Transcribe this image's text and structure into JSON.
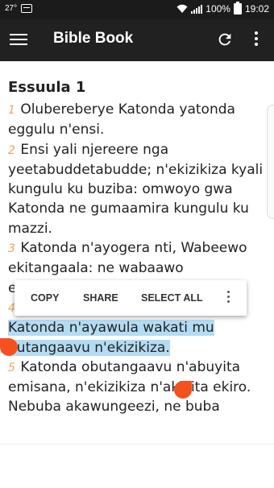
{
  "status_bar": {
    "left_text": "27°",
    "battery": "100%",
    "time": "19:02"
  },
  "app_bar": {
    "title": "Bible Book",
    "icons": [
      "menu-icon",
      "refresh-icon",
      "more-vert-icon"
    ]
  },
  "chapter": {
    "title": "Essuula 1",
    "verses": [
      {
        "num": "1",
        "text": "Olubereberye Katonda yatonda eggulu n'ensi."
      },
      {
        "num": "2",
        "text": "Ensi yali njereere nga yeetabuddetabudde; n'ekizikiza kyali kungulu ku buziba: omwoyo gwa Katonda ne gumaamira kungulu ku mazzi."
      },
      {
        "num": "3",
        "text": "Katonda n'ayogera nti, Wabeewo ekitangaala: ne wabaawo ekitangaala."
      },
      {
        "num": "4",
        "text": "Katonda n'alaba nga kirungi: Katonda n'ayawula wakati mu butangaavu n'ekizikiza."
      },
      {
        "num": "5",
        "text": "Katonda obutangaavu n'abuyita emisana, n'ekizikiza n'akiyita ekiro. Nebuba akawungeezi, ne buba"
      }
    ]
  },
  "context_menu": {
    "copy": "COPY",
    "share": "SHARE",
    "select_all": "SELECT ALL"
  },
  "colors": {
    "app_bar": "#212121",
    "verse_number": "#f0a45a",
    "selection": "#b3dcf3",
    "selection_handle": "#f4511e"
  }
}
